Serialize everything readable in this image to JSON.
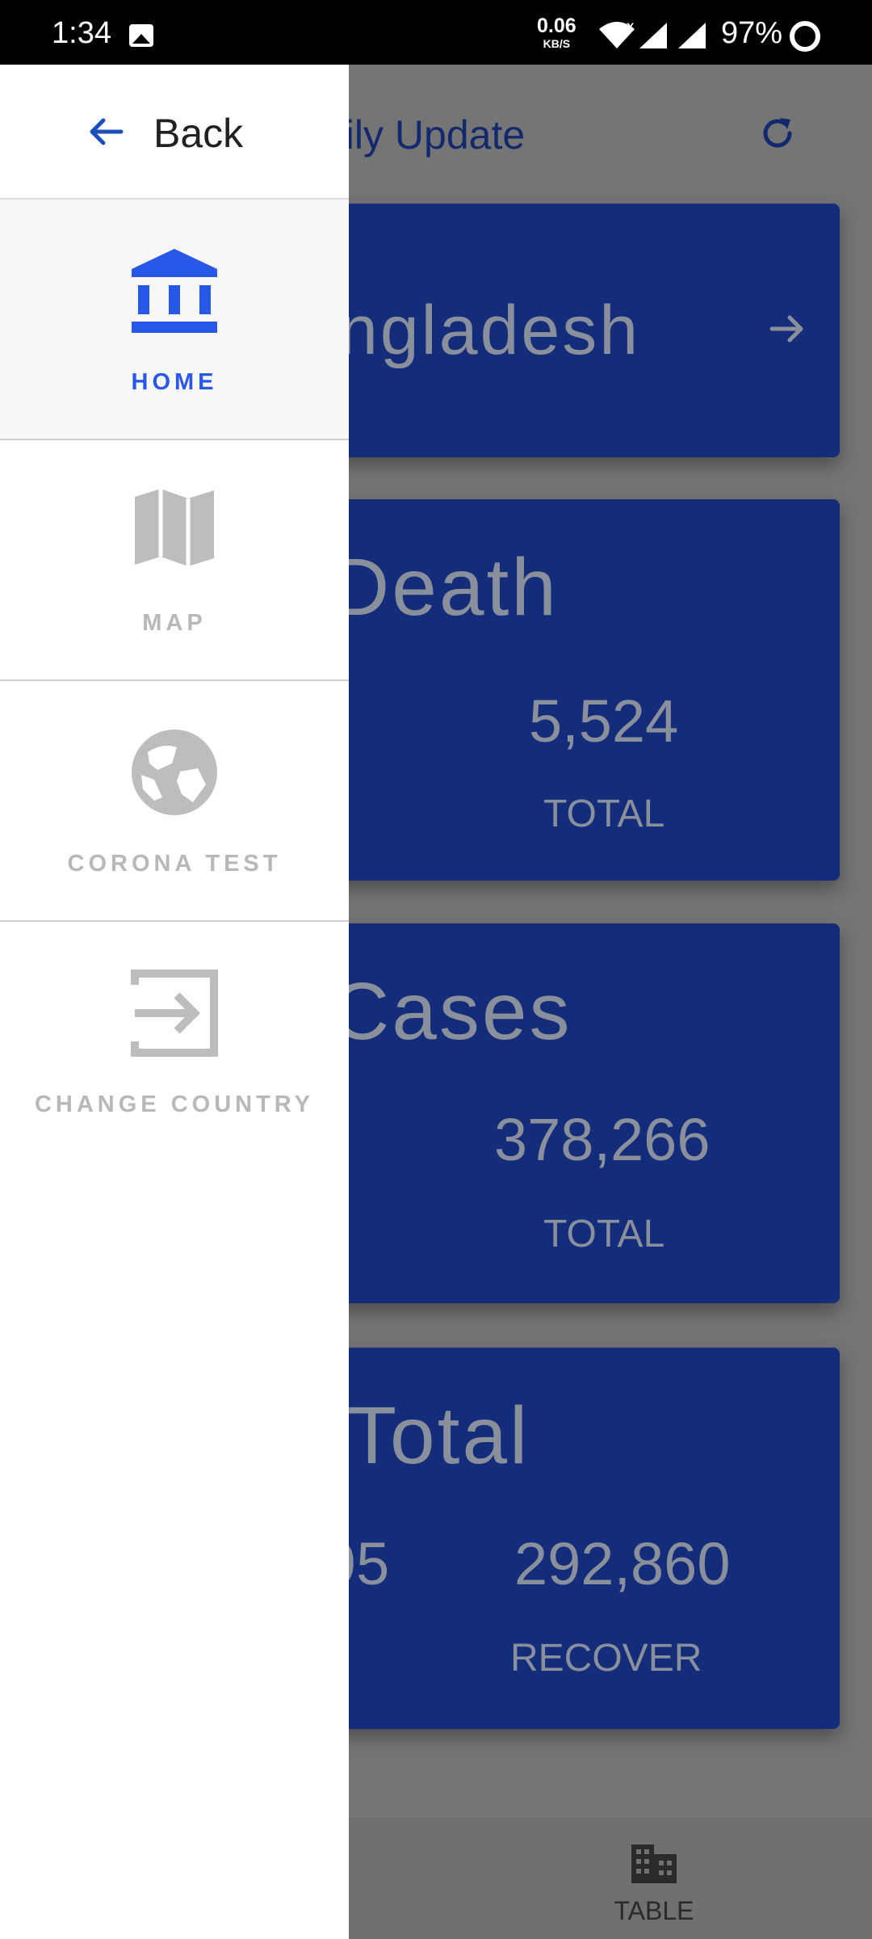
{
  "status_bar": {
    "time": "1:34",
    "speed_value": "0.06",
    "speed_unit": "KB/S",
    "network_mark": "X",
    "battery": "97%"
  },
  "background_app": {
    "title": "aily Update",
    "country_card": {
      "name": "ngladesh"
    },
    "death_card": {
      "heading": "Death",
      "value": "5,524",
      "label": "TOTAL"
    },
    "cases_card": {
      "heading": "Cases",
      "value": "378,266",
      "label": "TOTAL"
    },
    "total_card": {
      "heading": "Total",
      "left_value": "95",
      "value": "292,860",
      "label": "RECOVER"
    },
    "bottom_nav": {
      "table_label": "TABLE"
    }
  },
  "drawer": {
    "back_label": "Back",
    "items": [
      {
        "label": "HOME",
        "icon": "bank-icon",
        "active": true
      },
      {
        "label": "MAP",
        "icon": "map-icon",
        "active": false
      },
      {
        "label": "CORONA TEST",
        "icon": "globe-icon",
        "active": false
      },
      {
        "label": "CHANGE COUNTRY",
        "icon": "exit-icon",
        "active": false
      }
    ]
  },
  "colors": {
    "accent": "#2958e8",
    "card": "#142d7a",
    "scrim": "#757575",
    "inactive": "#b8b8b8"
  }
}
